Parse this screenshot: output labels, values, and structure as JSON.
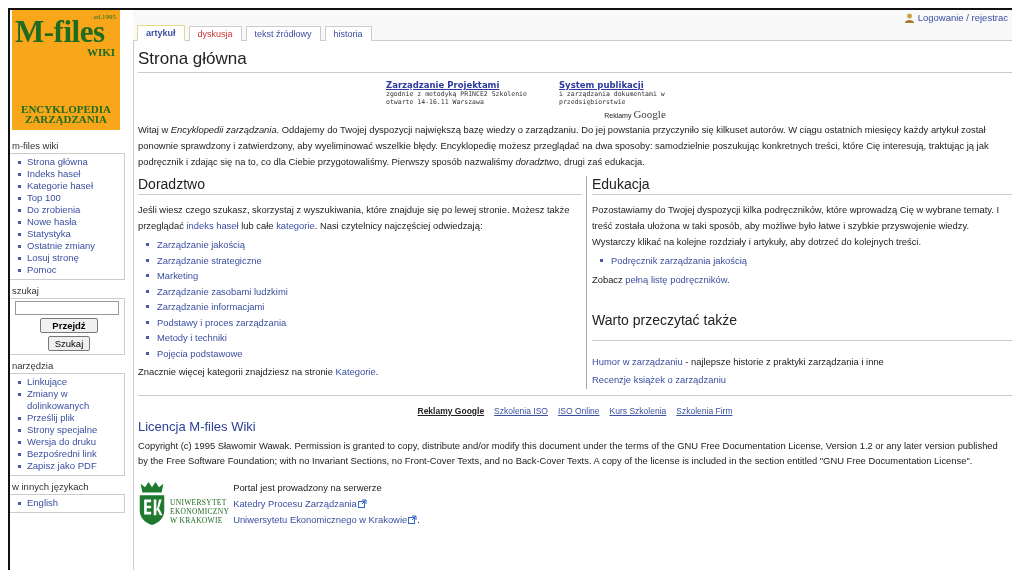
{
  "logo": {
    "title": "M-files",
    "edition": "ed.1995",
    "wiki": "WIKI",
    "subtitle": [
      "ENCYKLOPEDIA",
      "ZARZĄDZANIA"
    ]
  },
  "sidebar": {
    "navigation": {
      "title": "m-files wiki",
      "items": [
        "Strona główna",
        "Indeks haseł",
        "Kategorie haseł",
        "Top 100",
        "Do zrobienia",
        "Nowe hasła",
        "Statystyka",
        "Ostatnie zmiany",
        "Losuj stronę",
        "Pomoc"
      ]
    },
    "search": {
      "title": "szukaj",
      "buttons": [
        {
          "label": "Przejdź",
          "kind": "primary"
        },
        {
          "label": "Szukaj",
          "kind": "secondary"
        }
      ]
    },
    "tools": {
      "title": "narzędzia",
      "items": [
        "Linkujące",
        "Zmiany w dolinkowanych",
        "Prześlij plik",
        "Strony specjalne",
        "Wersja do druku",
        "Bezpośredni link",
        "Zapisz jako PDF"
      ]
    },
    "languages": {
      "title": "w innych językach",
      "items": [
        "English"
      ]
    }
  },
  "user_link": "Logowanie / rejestrac",
  "tabs": [
    {
      "label": "artykuł",
      "selected": true,
      "missing": false
    },
    {
      "label": "dyskusja",
      "selected": false,
      "missing": true
    },
    {
      "label": "tekst źródłowy",
      "selected": false,
      "missing": false
    },
    {
      "label": "historia",
      "selected": false,
      "missing": false
    }
  ],
  "page_title": "Strona główna",
  "ads": {
    "items": [
      {
        "title": "Zarządzanie Projektami",
        "description": "zgodnie z metodyką PRINCE2 Szkolenie otwarte 14-16.11 Warszawa"
      },
      {
        "title": "System publikacji",
        "description": "i zarządzania dokumentami w przedsiębiorstwie"
      }
    ],
    "label": "Reklamy",
    "brand": "Google"
  },
  "intro": "Witaj w *Encyklopedii zarządzania*. Oddajemy do Twojej dyspozycji największą bazę wiedzy o zarządzaniu. Do jej powstania przyczyniło się kilkuset autorów. W ciągu ostatnich miesięcy każdy artykuł został ponownie sprawdzony i zatwierdzony, aby wyeliminować wszelkie błędy. Encyklopedię możesz przeglądać na dwa sposoby: samodzielnie poszukując konkretnych treści, które Cię interesują, traktując ją jak podręcznik i zdając się na to, co dla Ciebie przygotowaliśmy. Pierwszy sposób nazwaliśmy *doradztwo*, drugi zaś edukacja.",
  "doradztwo": {
    "heading": "Doradztwo",
    "paragraph": [
      {
        "text": "Jeśli wiesz czego szukasz, skorzystaj z wyszukiwania, które znajduje się po lewej stronie. Możesz także przeglądać ",
        "link": false
      },
      {
        "text": "indeks haseł",
        "link": true
      },
      {
        "text": " lub całe ",
        "link": false
      },
      {
        "text": "kategorie",
        "link": true
      },
      {
        "text": ". Nasi czytelnicy najczęściej odwiedzają:",
        "link": false
      }
    ],
    "items": [
      "Zarządzanie jakością",
      "Zarządzanie strategiczne",
      "Marketing",
      "Zarządzanie zasobami ludzkimi",
      "Zarządzanie informacjami",
      "Podstawy i proces zarządzania",
      "Metody i techniki",
      "Pojęcia podstawowe"
    ],
    "footer": [
      {
        "text": "Znacznie więcej kategorii znajdziesz na stronie ",
        "link": false
      },
      {
        "text": "Kategorie",
        "link": true
      },
      {
        "text": ".",
        "link": false
      }
    ]
  },
  "edukacja": {
    "heading": "Edukacja",
    "paragraph_lines": [
      "Pozostawiamy do Twojej dyspozycji kilka podręczników, które wprowadzą Cię w wybrane tematy. I",
      "treść została ułożona w taki sposób, aby możliwe było łatwe i szybkie przyswojenie wiedzy.",
      "Wystarczy klikać na kolejne rozdziały i artykuły, aby dotrzeć do kolejnych treści."
    ],
    "items": [
      "Podręcznik zarządzania jakością"
    ],
    "footer": [
      {
        "text": "Zobacz ",
        "link": false
      },
      {
        "text": "pełną listę podręczników",
        "link": true
      },
      {
        "text": ".",
        "link": false
      }
    ]
  },
  "warto": {
    "heading": "Warto przeczytać także",
    "lines": [
      [
        {
          "text": "Humor w zarządzaniu",
          "link": true
        },
        {
          "text": " - najlepsze historie z praktyki zarządzania i inne",
          "link": false
        }
      ],
      [
        {
          "text": "Recenzje książek o zarządzaniu",
          "link": true
        }
      ]
    ]
  },
  "ad_links": [
    {
      "text": "Reklamy Google",
      "kind": "label"
    },
    {
      "text": "Szkolenia ISO",
      "kind": "link"
    },
    {
      "text": "ISO Online",
      "kind": "link"
    },
    {
      "text": "Kurs Szkolenia",
      "kind": "link"
    },
    {
      "text": "Szkolenia Firm",
      "kind": "link"
    }
  ],
  "license": {
    "heading": "Licencja M-files Wiki",
    "text": "Copyright (c) 1995 Sławomir Wawak. Permission is granted to copy, distribute and/or modify this document under the terms of the GNU Free Documentation License, Version 1.2 or any later version published by the Free Software Foundation; with no Invariant Sections, no Front-Cover Texts, and no Back-Cover Texts. A copy of the license is included in the section entitled \"GNU Free Documentation License\"."
  },
  "university": {
    "name": [
      "UNIWERSYTET",
      "EKONOMICZNY",
      "W KRAKOWIE"
    ],
    "intro": "Portal jest prowadzony na serwerze",
    "links": [
      {
        "text": "Katedry Procesu Zarządzania"
      },
      {
        "text": "Uniwersytetu Ekonomicznego w Krakowie",
        "after": "."
      }
    ]
  }
}
